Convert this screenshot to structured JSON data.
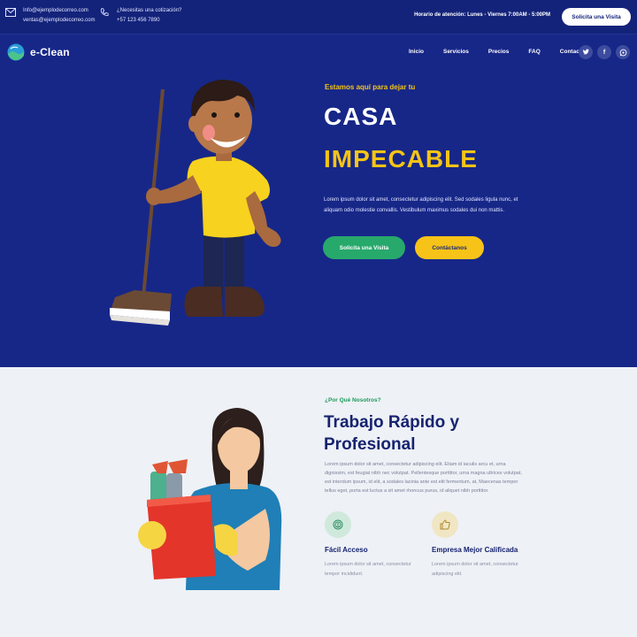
{
  "topbar": {
    "email_line1": "Info@ejemplodecorreo.com",
    "email_line2": "ventas@ejemplodecorreo.com",
    "phone_line1": "¿Necesitas una cotización?",
    "phone_line2": "+57 123 456 7890",
    "hours": "Horario de atención: Lunes - Viernes 7:00AM - 5:00PM",
    "cta": "Solicita una Visita"
  },
  "nav": {
    "logo": "e-Clean",
    "items": [
      "Inicio",
      "Servicios",
      "Precios",
      "FAQ",
      "Contacto"
    ],
    "socials": [
      "twitter-icon",
      "facebook-icon",
      "whatsapp-icon"
    ]
  },
  "hero": {
    "kicker": "Estamos aquí para dejar tu",
    "title_line1": "CASA",
    "title_line2": "IMPECABLE",
    "description": "Lorem ipsum dolor sit amet, consectetur adipiscing elit. Sed sodales ligula nunc, et aliquam odio molestie convallis. Vestibulum maximus sodales dui non mattis.",
    "primary_button": "Solicita una Visita",
    "secondary_button": "Contáctanos"
  },
  "about": {
    "kicker": "¿Por Qué Nosotros?",
    "title": "Trabajo Rápido y Profesional",
    "description": "Lorem ipsum dolor sit amet, consectetur adipiscing elit. Etiam id iaculis arcu et, urna dignissim, est feugiat nibh nec volutpat. Pellentesque porttitor, urna magna ultrices volutpat, est interdum ipsum, id elit, a sodales lacinia ante est elit fermentum, at, Maecenas tempor tellus eget, porta est luctus a sit amet rhoncus purus, id aliquet nibh porttitor.",
    "features": [
      {
        "title": "Fácil Acceso",
        "description": "Lorem ipsum dolor sit amet, consectetur tempor incididunt.",
        "icon": "fingerprint-icon"
      },
      {
        "title": "Empresa Mejor Calificada",
        "description": "Lorem ipsum dolor sit amet, consectetur adipiscing elit.",
        "icon": "thumbs-up-icon"
      }
    ]
  },
  "colors": {
    "primary": "#172788",
    "accent_yellow": "#f6c416",
    "accent_green": "#27a96c"
  }
}
